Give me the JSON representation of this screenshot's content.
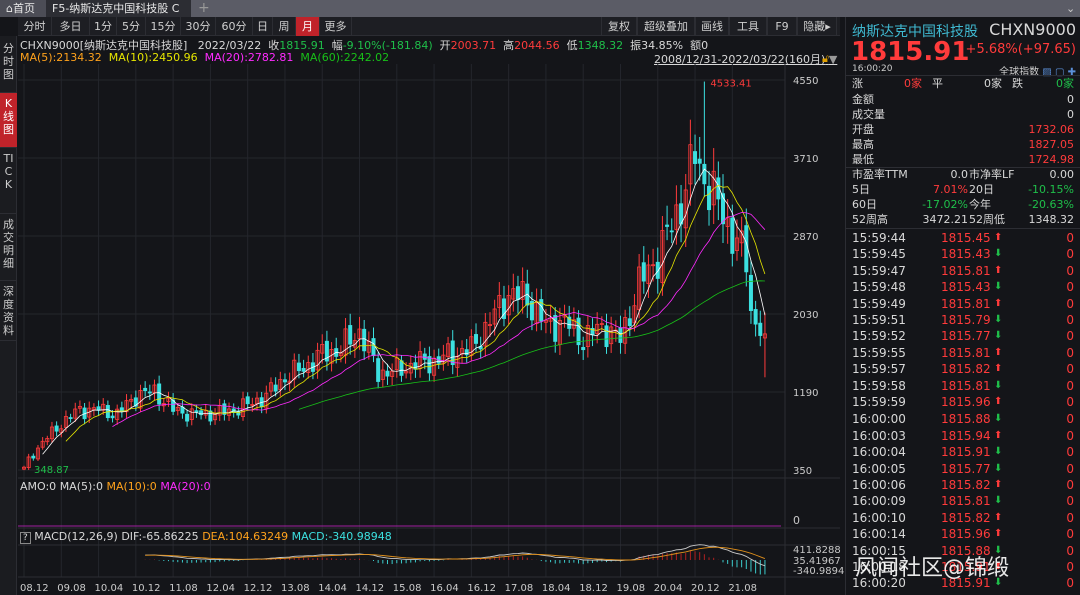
{
  "tabs": {
    "home": "首页",
    "active": "F5-纳斯达克中国科技股 C",
    "close": "✕",
    "add": "+",
    "dropdown": "⌄"
  },
  "periods": [
    "分时",
    "多日",
    "1分",
    "5分",
    "15分",
    "30分",
    "60分",
    "日",
    "周",
    "月",
    "更多"
  ],
  "active_period": "月",
  "tools": [
    "复权",
    "超级叠加",
    "画线",
    "工具",
    "F9",
    "隐藏▸"
  ],
  "sidebar": [
    "分时图",
    "K线图",
    "TICK",
    "成交明细",
    "深度资料"
  ],
  "info": {
    "code": "CHXN9000[纳斯达克中国科技股]",
    "date": "2022/03/22",
    "close_label": "收",
    "close": "1815.91",
    "range_label": "幅",
    "range": "-9.10%(-181.84)",
    "open_label": "开",
    "open": "2003.71",
    "high_label": "高",
    "high": "2044.56",
    "low_label": "低",
    "low": "1348.32",
    "amp_label": "振",
    "amp": "34.85%",
    "amt_label": "额",
    "amt": "0",
    "period_range": "2008/12/31-2022/03/22(160月)"
  },
  "ma": {
    "ma5": "MA(5):2134.32",
    "ma10": "MA(10):2450.96",
    "ma20": "MA(20):2782.81",
    "ma60": "MA(60):2242.02"
  },
  "amo": {
    "amo": "AMO:0",
    "ma5": "MA(5):0",
    "ma10": "MA(10):0",
    "ma20": "MA(20):0",
    "zero": "0"
  },
  "macd": {
    "help": "?",
    "name": "MACD(12,26,9)",
    "dif": "DIF:-65.86225",
    "dea": "DEA:104.63249",
    "macd": "MACD:-340.98948",
    "axis": [
      "411.8288",
      "35.41967",
      "-340.9894"
    ]
  },
  "colors": {
    "up": "#ff3b3b",
    "down": "#3ce0e0",
    "ma5": "#ffffff",
    "ma10": "#e6e600",
    "ma20": "#ff2bff",
    "ma60": "#18c018"
  },
  "chart_data": {
    "type": "candlestick",
    "title": "CHXN9000 monthly",
    "ylim": [
      350,
      4550
    ],
    "yticks": [
      "4550",
      "3710",
      "2870",
      "2030",
      "1190",
      "350"
    ],
    "xticks": [
      "08.12",
      "09.08",
      "10.04",
      "10.12",
      "11.08",
      "12.04",
      "12.12",
      "13.08",
      "14.04",
      "14.12",
      "15.08",
      "16.04",
      "16.12",
      "17.08",
      "18.04",
      "18.12",
      "19.08",
      "20.04",
      "20.12",
      "21.08"
    ],
    "annotations": {
      "max": "4533.41",
      "min": "348.87"
    },
    "approx_close_every_4_months": [
      400,
      650,
      850,
      1000,
      1000,
      950,
      1150,
      1200,
      1000,
      950,
      960,
      980,
      1050,
      1150,
      1350,
      1450,
      1600,
      1650,
      1850,
      1400,
      1420,
      1500,
      1520,
      1600,
      1650,
      1950,
      2250,
      2200,
      1900,
      1950,
      1750,
      1900,
      1750,
      2350,
      2650,
      3100,
      3700,
      3300,
      2900,
      2500,
      2050
    ],
    "last_close": 1815.91,
    "months": 160
  },
  "quote": {
    "name": "纳斯达克中国科技股",
    "code": "CHXN9000",
    "price": "1815.91",
    "change": "+5.68%(+97.65)",
    "time": "16:00:20",
    "global": "全球指数"
  },
  "breadth": {
    "up_label": "涨",
    "up": "0家",
    "flat_label": "平",
    "flat": "0家",
    "down_label": "跌",
    "down": "0家"
  },
  "stats": [
    {
      "k": "金额",
      "v": "0",
      "c": "w"
    },
    {
      "k": "成交量",
      "v": "0",
      "c": "w"
    },
    {
      "k": "开盘",
      "v": "1732.06",
      "c": "r"
    },
    {
      "k": "最高",
      "v": "1827.05",
      "c": "r"
    },
    {
      "k": "最低",
      "v": "1724.98",
      "c": "r"
    }
  ],
  "ratios": [
    {
      "k1": "市盈率TTM",
      "v1": "0.0",
      "c1": "w",
      "k2": "市净率LF",
      "v2": "0.00",
      "c2": "w"
    },
    {
      "k1": "5日",
      "v1": "7.01%",
      "c1": "r",
      "k2": "20日",
      "v2": "-10.15%",
      "c2": "g"
    },
    {
      "k1": "60日",
      "v1": "-17.02%",
      "c1": "g",
      "k2": "今年",
      "v2": "-20.63%",
      "c2": "g"
    },
    {
      "k1": "52周高",
      "v1": "3472.21",
      "c1": "w",
      "k2": "52周低",
      "v2": "1348.32",
      "c2": "w"
    }
  ],
  "ticks": [
    [
      "15:59:44",
      "1815.45",
      "up",
      "0"
    ],
    [
      "15:59:45",
      "1815.43",
      "down",
      "0"
    ],
    [
      "15:59:47",
      "1815.81",
      "up",
      "0"
    ],
    [
      "15:59:48",
      "1815.43",
      "down",
      "0"
    ],
    [
      "15:59:49",
      "1815.81",
      "up",
      "0"
    ],
    [
      "15:59:51",
      "1815.79",
      "down",
      "0"
    ],
    [
      "15:59:52",
      "1815.77",
      "down",
      "0"
    ],
    [
      "15:59:55",
      "1815.81",
      "up",
      "0"
    ],
    [
      "15:59:57",
      "1815.82",
      "up",
      "0"
    ],
    [
      "15:59:58",
      "1815.81",
      "down",
      "0"
    ],
    [
      "15:59:59",
      "1815.96",
      "up",
      "0"
    ],
    [
      "16:00:00",
      "1815.88",
      "down",
      "0"
    ],
    [
      "16:00:03",
      "1815.94",
      "up",
      "0"
    ],
    [
      "16:00:04",
      "1815.91",
      "down",
      "0"
    ],
    [
      "16:00:05",
      "1815.77",
      "down",
      "0"
    ],
    [
      "16:00:06",
      "1815.82",
      "up",
      "0"
    ],
    [
      "16:00:09",
      "1815.81",
      "down",
      "0"
    ],
    [
      "16:00:10",
      "1815.82",
      "up",
      "0"
    ],
    [
      "16:00:14",
      "1815.96",
      "up",
      "0"
    ],
    [
      "16:00:15",
      "1815.88",
      "down",
      "0"
    ],
    [
      "16:00:18",
      "1815.91",
      "up",
      "0"
    ],
    [
      "16:00:20",
      "1815.91",
      "down",
      "0"
    ]
  ],
  "watermark": "风闻社区@锦缎"
}
